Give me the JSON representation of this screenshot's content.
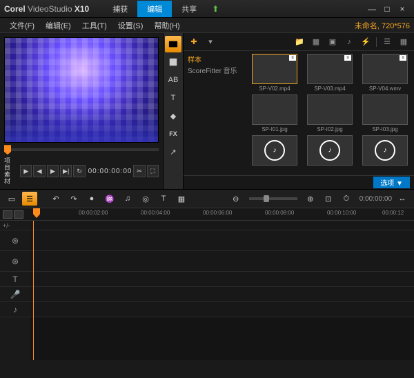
{
  "brand": {
    "name": "Corel",
    "prod": "VideoStudio",
    "ver": "X10"
  },
  "tabs": {
    "capture": "捕获",
    "edit": "编辑",
    "share": "共享"
  },
  "win": {
    "min": "—",
    "max": "□",
    "close": "×"
  },
  "menu": {
    "file": "文件(F)",
    "edit": "编辑(E)",
    "tool": "工具(T)",
    "set": "设置(S)",
    "help": "帮助(H)"
  },
  "doc": {
    "name": "未命名",
    "dims": "720*576"
  },
  "preview": {
    "proj": "项目",
    "clip": "素材",
    "tc": "00:00:00:00"
  },
  "sideTools": {
    "fx": "FX",
    "t": "T",
    "ab": "AB"
  },
  "lib": {
    "sample": "样本",
    "sf": "ScoreFitter 音乐",
    "items": [
      {
        "cap": "SP-V02.mp4"
      },
      {
        "cap": "SP-V03.mp4"
      },
      {
        "cap": "SP-V04.wmv"
      },
      {
        "cap": "SP-I01.jpg"
      },
      {
        "cap": "SP-I02.jpg"
      },
      {
        "cap": "SP-I03.jpg"
      },
      {
        "cap": ""
      },
      {
        "cap": ""
      },
      {
        "cap": ""
      }
    ],
    "opt": "选项 ▼"
  },
  "ruler": {
    "marks": [
      "00:00:02:00",
      "00:00:04:00",
      "00:00:06:00",
      "00:00:08:00",
      "00:00:10:00",
      "00:00:12"
    ]
  },
  "tl": {
    "tc": "0:00:00:00",
    "plus": "+/-"
  }
}
